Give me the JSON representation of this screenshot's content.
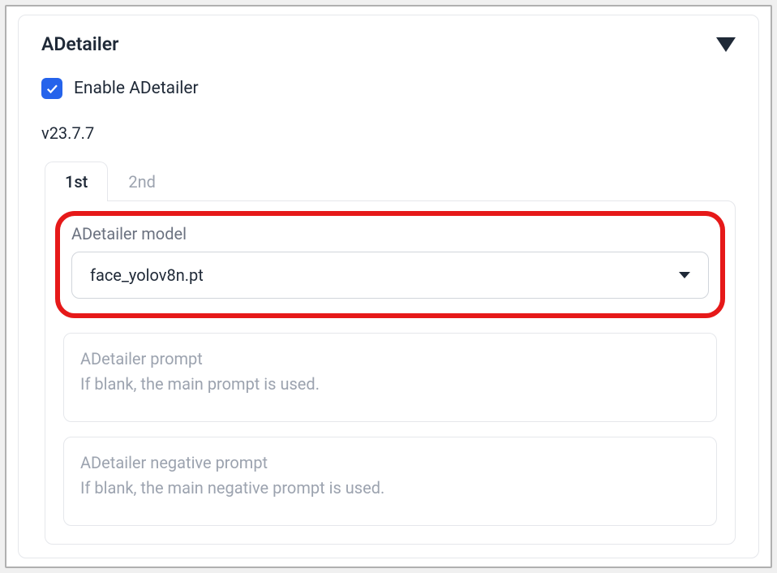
{
  "panel": {
    "title": "ADetailer",
    "enable_label": "Enable ADetailer",
    "enable_checked": true,
    "version": "v23.7.7"
  },
  "tabs": {
    "first": "1st",
    "second": "2nd"
  },
  "model": {
    "label": "ADetailer model",
    "value": "face_yolov8n.pt"
  },
  "prompt": {
    "line1": "ADetailer prompt",
    "line2": "If blank, the main prompt is used."
  },
  "neg_prompt": {
    "line1": "ADetailer negative prompt",
    "line2": "If blank, the main negative prompt is used."
  },
  "colors": {
    "accent": "#2563eb",
    "highlight": "#e61919"
  }
}
